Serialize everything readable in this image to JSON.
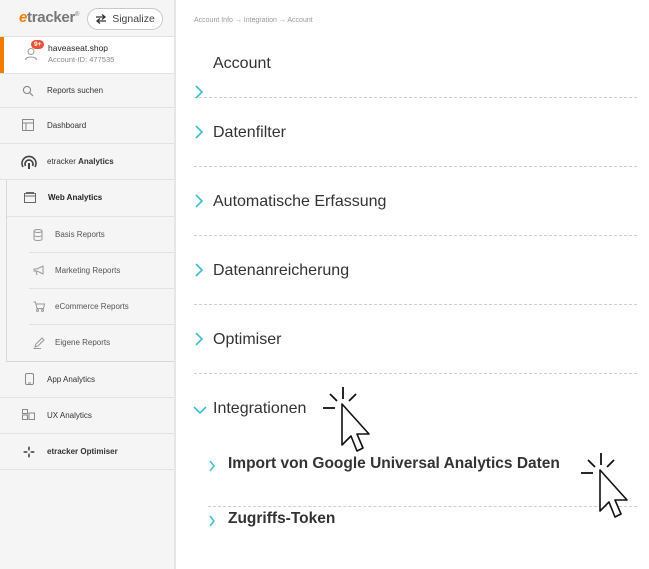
{
  "sidebar": {
    "logo": {
      "e": "e",
      "rest": "tracker",
      "mark": "®"
    },
    "signalize_label": "Signalize",
    "account": {
      "badge": "9+",
      "name": "haveaseat.shop",
      "id": "Account-ID: 477535"
    },
    "items": [
      {
        "label": "Reports suchen",
        "icon": "search-icon"
      },
      {
        "label": "Dashboard",
        "icon": "dashboard-icon"
      }
    ],
    "analytics": {
      "prefix": "etracker ",
      "bold": "Analytics",
      "icon": "analytics-icon"
    },
    "web_analytics": {
      "label": "Web Analytics",
      "icon": "browser-icon",
      "items": [
        {
          "label": "Basis Reports",
          "icon": "database-icon"
        },
        {
          "label": "Marketing Reports",
          "icon": "megaphone-icon"
        },
        {
          "label": "eCommerce Reports",
          "icon": "cart-icon"
        },
        {
          "label": "Eigene Reports",
          "icon": "pencil-icon"
        }
      ]
    },
    "app_analytics": {
      "label": "App Analytics",
      "icon": "phone-icon"
    },
    "ux_analytics": {
      "label": "UX Analytics",
      "icon": "ux-icon"
    },
    "optimiser": {
      "label": "etracker Optimiser",
      "icon": "fan-icon"
    }
  },
  "main": {
    "breadcrumb": "Account Info → Integration → Account",
    "sections": [
      {
        "title": "Account",
        "expanded": false
      },
      {
        "title": "Datenfilter",
        "expanded": false
      },
      {
        "title": "Automatische Erfassung",
        "expanded": false
      },
      {
        "title": "Datenanreicherung",
        "expanded": false
      },
      {
        "title": "Optimiser",
        "expanded": false
      },
      {
        "title": "Integrationen",
        "expanded": true
      }
    ],
    "subsections": [
      {
        "title": "Import von Google Universal Analytics Daten"
      },
      {
        "title": "Zugriffs-Token"
      }
    ]
  },
  "colors": {
    "accent": "#3bbfcf",
    "brand": "#f07d00",
    "badge": "#e8523a"
  }
}
